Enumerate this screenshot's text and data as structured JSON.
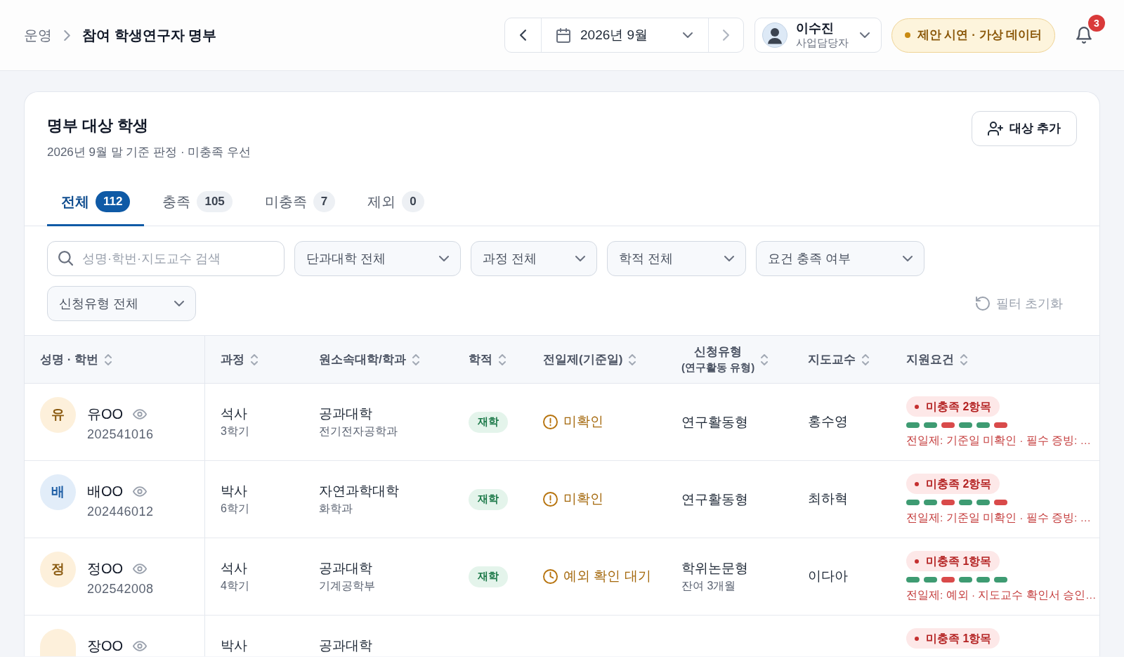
{
  "breadcrumb": [
    {
      "label": "운영",
      "current": false
    },
    {
      "label": "참여 학생연구자 명부",
      "current": true
    }
  ],
  "period": {
    "label": "2026년 9월"
  },
  "user": {
    "name": "이수진",
    "role": "사업담당자"
  },
  "demo_badge": {
    "label": "제안 시연 · 가상 데이터"
  },
  "notifications": {
    "count": "3"
  },
  "panel": {
    "title": "명부 대상 학생",
    "subtitle": "2026년 9월 말 기준 판정 · 미충족 우선",
    "add_button": "대상 추가"
  },
  "tabs": [
    {
      "label": "전체",
      "count": "112",
      "selected": true
    },
    {
      "label": "충족",
      "count": "105",
      "selected": false
    },
    {
      "label": "미충족",
      "count": "7",
      "selected": false
    },
    {
      "label": "제외",
      "count": "0",
      "selected": false
    }
  ],
  "filters": {
    "search": {
      "placeholder": "성명·학번·지도교수 검색"
    },
    "dropdowns": [
      {
        "label": "단과대학 전체"
      },
      {
        "label": "과정 전체"
      },
      {
        "label": "학적 전체"
      },
      {
        "label": "요건 충족 여부"
      },
      {
        "label": "신청유형 전체"
      }
    ],
    "reset": "필터 초기화"
  },
  "table": {
    "columns": [
      {
        "label": "성명 · 학번"
      },
      {
        "label": "과정"
      },
      {
        "label": "원소속대학/학과"
      },
      {
        "label": "학적"
      },
      {
        "label": "전일제(기준일)"
      },
      {
        "label": "신청유형",
        "sublabel": "(연구활동 유형)"
      },
      {
        "label": "지도교수"
      },
      {
        "label": "지원요건"
      }
    ],
    "rows": [
      {
        "avatar": {
          "initial": "유",
          "color": "#fdf0db"
        },
        "name": "유OO",
        "student_id": "202541016",
        "course": "석사",
        "semester": "3학기",
        "college": "공과대학",
        "department": "전기전자공학과",
        "status": "재학",
        "full_time": {
          "kind": "unconfirmed",
          "label": "미확인"
        },
        "apply_type": "연구활동형",
        "advisor": "홍수영",
        "requirement": {
          "summary": "미충족 2항목",
          "checks": [
            {
              "met": true
            },
            {
              "met": true
            },
            {
              "met": false
            },
            {
              "met": true
            },
            {
              "met": true
            },
            {
              "met": false
            }
          ],
          "detail": "전일제: 기준일 미확인 · 필수 증빙: …"
        }
      },
      {
        "avatar": {
          "initial": "배",
          "color": "#e2edf9"
        },
        "name": "배OO",
        "student_id": "202446012",
        "course": "박사",
        "semester": "6학기",
        "college": "자연과학대학",
        "department": "화학과",
        "status": "재학",
        "full_time": {
          "kind": "unconfirmed",
          "label": "미확인"
        },
        "apply_type": "연구활동형",
        "advisor": "최하혁",
        "requirement": {
          "summary": "미충족 2항목",
          "checks": [
            {
              "met": true
            },
            {
              "met": true
            },
            {
              "met": false
            },
            {
              "met": true
            },
            {
              "met": true
            },
            {
              "met": false
            }
          ],
          "detail": "전일제: 기준일 미확인 · 필수 증빙: …"
        }
      },
      {
        "avatar": {
          "initial": "정",
          "color": "#fdf0db"
        },
        "name": "정OO",
        "student_id": "202542008",
        "course": "석사",
        "semester": "4학기",
        "college": "공과대학",
        "department": "기계공학부",
        "status": "재학",
        "full_time": {
          "kind": "pending",
          "label": "예외 확인 대기"
        },
        "apply_type": "학위논문형",
        "apply_note": "잔여 3개월",
        "advisor": "이다아",
        "requirement": {
          "summary": "미충족 1항목",
          "checks": [
            {
              "met": true
            },
            {
              "met": true
            },
            {
              "met": false
            },
            {
              "met": true
            },
            {
              "met": true
            },
            {
              "met": true
            }
          ],
          "detail": "전일제: 예외 · 지도교수 확인서 승인…"
        }
      },
      {
        "avatar": {
          "color": "#fdf0db"
        },
        "name": "장OO",
        "course": "박사",
        "college": "공과대학",
        "requirement": {
          "summary": "미충족 1항목"
        }
      }
    ]
  }
}
